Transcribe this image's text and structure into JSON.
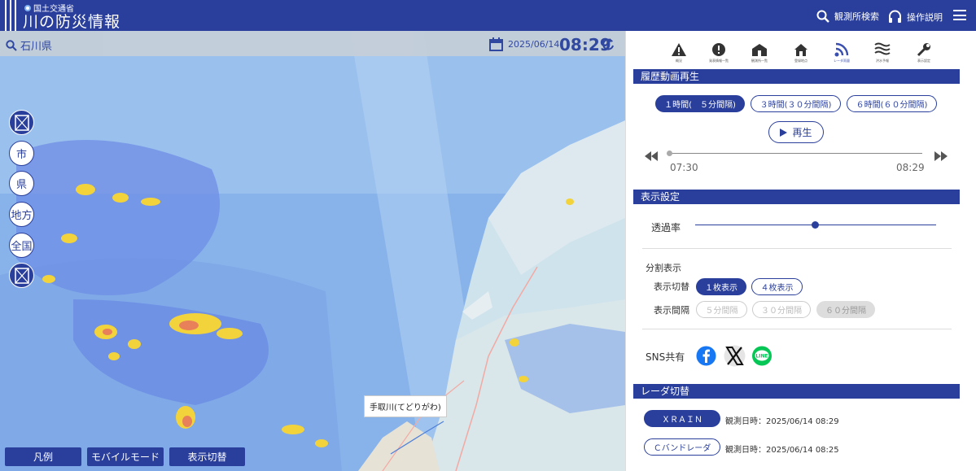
{
  "header": {
    "ministry": "国土交通省",
    "title": "川の防災情報",
    "search_label": "観測所検索",
    "help_label": "操作説明"
  },
  "mapbar": {
    "prefecture": "石川県",
    "date": "2025/06/14",
    "time": "08:29"
  },
  "map_controls": {
    "city": "市",
    "prefecture": "県",
    "region": "地方",
    "national": "全国"
  },
  "map_labels": {
    "river_popup": "手取川(てどりがわ)"
  },
  "map_buttons": {
    "legend": "凡例",
    "mobile": "モバイルモード",
    "display_toggle": "表示切替"
  },
  "toolbar": {
    "icons": [
      {
        "name": "warning-icon",
        "label": "概況"
      },
      {
        "name": "alert-icon",
        "label": "発表情報一覧"
      },
      {
        "name": "station-list-icon",
        "label": "観測所一覧"
      },
      {
        "name": "home-icon",
        "label": "登録地点"
      },
      {
        "name": "radar-icon",
        "label": "レーダ雨量"
      },
      {
        "name": "water-level-icon",
        "label": "洪水予報"
      },
      {
        "name": "tools-icon",
        "label": "表示設定"
      }
    ]
  },
  "history": {
    "title": "履歴動画再生",
    "ranges": [
      "１時間(　５分間隔)",
      "３時間(３０分間隔)",
      "６時間(６０分間隔)"
    ],
    "play": "再生",
    "start": "07:30",
    "end": "08:29",
    "progress": 0.0
  },
  "display": {
    "title": "表示設定",
    "opacity_label": "透過率",
    "opacity_value": 0.5,
    "split_label": "分割表示",
    "switch_label": "表示切替",
    "switch_options": [
      "１枚表示",
      "４枚表示"
    ],
    "interval_label": "表示間隔",
    "interval_options": [
      "５分間隔",
      "３０分間隔",
      "６０分間隔"
    ],
    "sns_label": "SNS共有"
  },
  "radar": {
    "title": "レーダ切替",
    "xrain_label": "ＸＲＡＩＮ",
    "xrain_time": "観測日時：2025/06/14 08:29",
    "cband_label": "Ｃバンドレーダ",
    "cband_time": "観測日時：2025/06/14 08:25"
  },
  "colors": {
    "brand": "#2a3f9b",
    "rain_light": "#7aa8e8",
    "rain_mid": "#4a63e6",
    "rain_heavy": "#f2d33c",
    "rain_extreme": "#e8805a"
  }
}
